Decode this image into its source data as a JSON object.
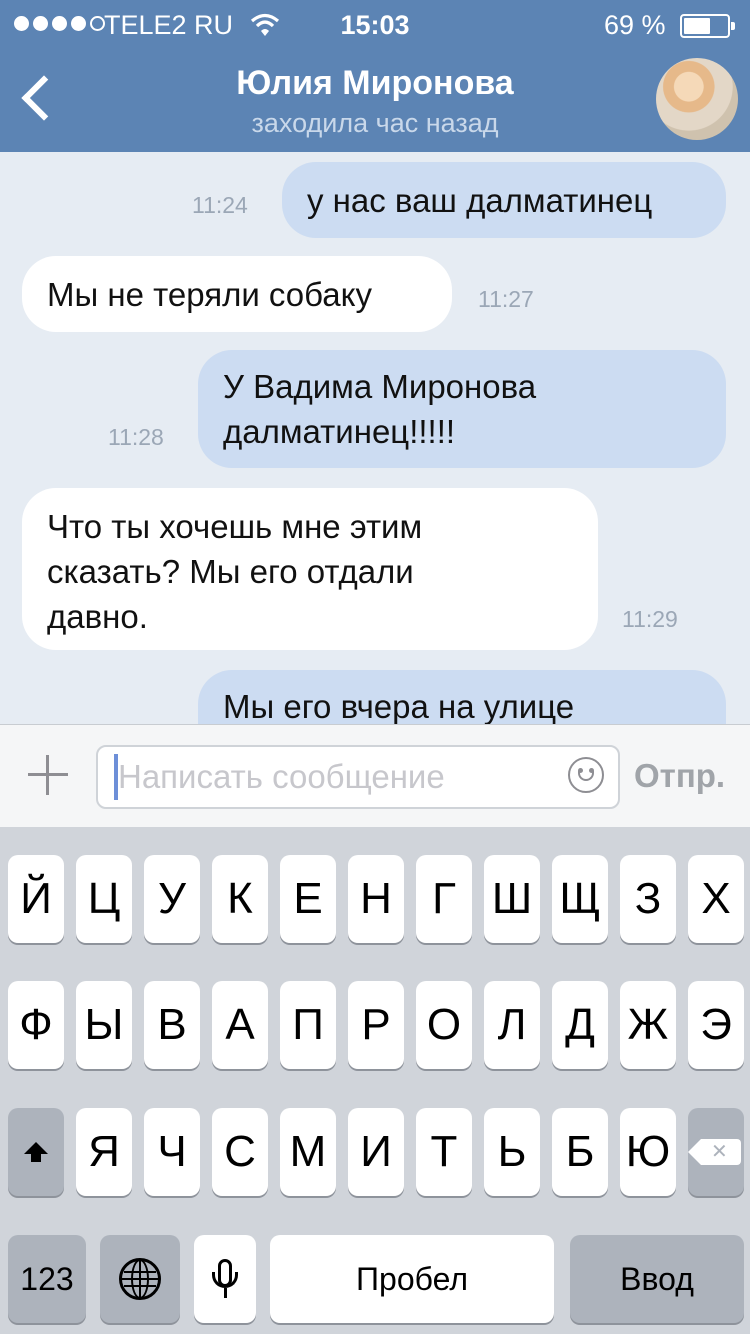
{
  "status_bar": {
    "carrier": "TELE2 RU",
    "time": "15:03",
    "battery": "69 %",
    "battery_level": 0.69
  },
  "header": {
    "title": "Юлия Миронова",
    "subtitle": "заходила час назад"
  },
  "messages": [
    {
      "direction": "out",
      "text": "у нас ваш далматинец",
      "time": "11:24"
    },
    {
      "direction": "in",
      "text": "Мы не теряли собаку",
      "time": "11:27"
    },
    {
      "direction": "out",
      "text": "У Вадима Миронова\nдалматинец!!!!!",
      "time": "11:28"
    },
    {
      "direction": "in",
      "text": "Что ты хочешь мне этим\nсказать? Мы его отдали\nдавно.",
      "time": "11:29"
    },
    {
      "direction": "out",
      "text": "Мы его вчера на улице",
      "time": ""
    }
  ],
  "composer": {
    "placeholder": "Написать сообщение",
    "send_label": "Отпр.",
    "value": ""
  },
  "keyboard": {
    "row1": [
      "Й",
      "Ц",
      "У",
      "К",
      "Е",
      "Н",
      "Г",
      "Ш",
      "Щ",
      "З",
      "Х"
    ],
    "row2": [
      "Ф",
      "Ы",
      "В",
      "А",
      "П",
      "Р",
      "О",
      "Л",
      "Д",
      "Ж",
      "Э"
    ],
    "row3": [
      "Я",
      "Ч",
      "С",
      "М",
      "И",
      "Т",
      "Ь",
      "Б",
      "Ю"
    ],
    "numbers_label": "123",
    "space_label": "Пробел",
    "return_label": "Ввод"
  },
  "icons": {
    "back": "chevron-left-icon",
    "attach": "plus-icon",
    "emoji": "smile-icon",
    "shift": "shift-icon",
    "backspace": "backspace-icon",
    "globe": "globe-icon",
    "mic": "microphone-icon"
  },
  "colors": {
    "header": "#5c84b4",
    "background": "#e6ecf3",
    "outgoing_bubble": "#ccdcf2",
    "incoming_bubble": "#ffffff",
    "keyboard": "#d0d4da"
  }
}
